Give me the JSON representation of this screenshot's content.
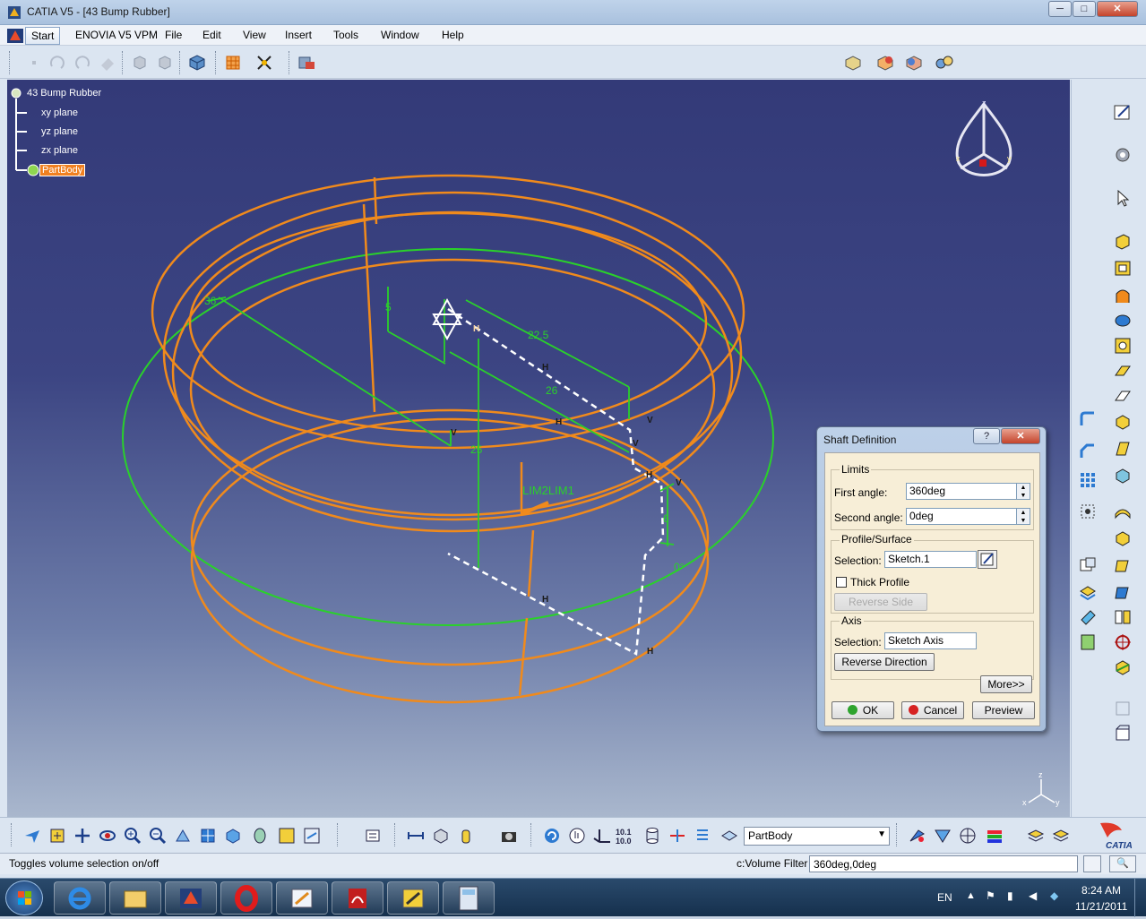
{
  "window": {
    "title": "CATIA V5 - [43 Bump Rubber]",
    "minimize": "─",
    "maximize": "□",
    "close": "✕"
  },
  "menu": {
    "items": [
      "Start",
      "ENOVIA V5 VPM",
      "File",
      "Edit",
      "View",
      "Insert",
      "Tools",
      "Window",
      "Help"
    ]
  },
  "tree": {
    "root": "43 Bump Rubber",
    "children": [
      "xy plane",
      "yz plane",
      "zx plane",
      "PartBody"
    ]
  },
  "viewport": {
    "compass_axis_x": "x",
    "compass_axis_y": "y",
    "compass_axis_z": "z",
    "dimensions": [
      "5",
      "22.5",
      "26",
      "36",
      "25",
      "6",
      "0°"
    ],
    "constraint_labels": [
      "H",
      "V",
      "H",
      "H",
      "H",
      "V",
      "V",
      "V",
      "H",
      "H"
    ],
    "limit_label": "LIM2LIM1",
    "axis_x": "x",
    "axis_y": "y",
    "axis_z": "z"
  },
  "dialog": {
    "title": "Shaft Definition",
    "help": "?",
    "close": "✕",
    "limits": {
      "group_label": "Limits",
      "first_angle_label": "First angle:",
      "first_angle_value": "360deg",
      "second_angle_label": "Second angle:",
      "second_angle_value": "0deg"
    },
    "profile": {
      "group_label": "Profile/Surface",
      "selection_label": "Selection:",
      "selection_value": "Sketch.1",
      "thick_profile_label": "Thick Profile",
      "thick_profile_checked": false,
      "reverse_side_label": "Reverse Side"
    },
    "axis": {
      "group_label": "Axis",
      "selection_label": "Selection:",
      "selection_value": "Sketch Axis",
      "reverse_direction_label": "Reverse Direction"
    },
    "more_label": "More>>",
    "ok_label": "OK",
    "cancel_label": "Cancel",
    "preview_label": "Preview"
  },
  "bottom_toolbar": {
    "current_body": "PartBody",
    "catia_logo": "CATIA"
  },
  "status": {
    "message": "Toggles volume selection on/off",
    "filter_label": "c:Volume Filter",
    "filter_value": "360deg,0deg"
  },
  "taskbar": {
    "language": "EN",
    "time": "8:24 AM",
    "date": "11/21/2011"
  },
  "colors": {
    "geometry": "#f08a1c",
    "sketch": "#2ad12a",
    "viewport_top": "#333a78",
    "selection": "#f08020"
  }
}
